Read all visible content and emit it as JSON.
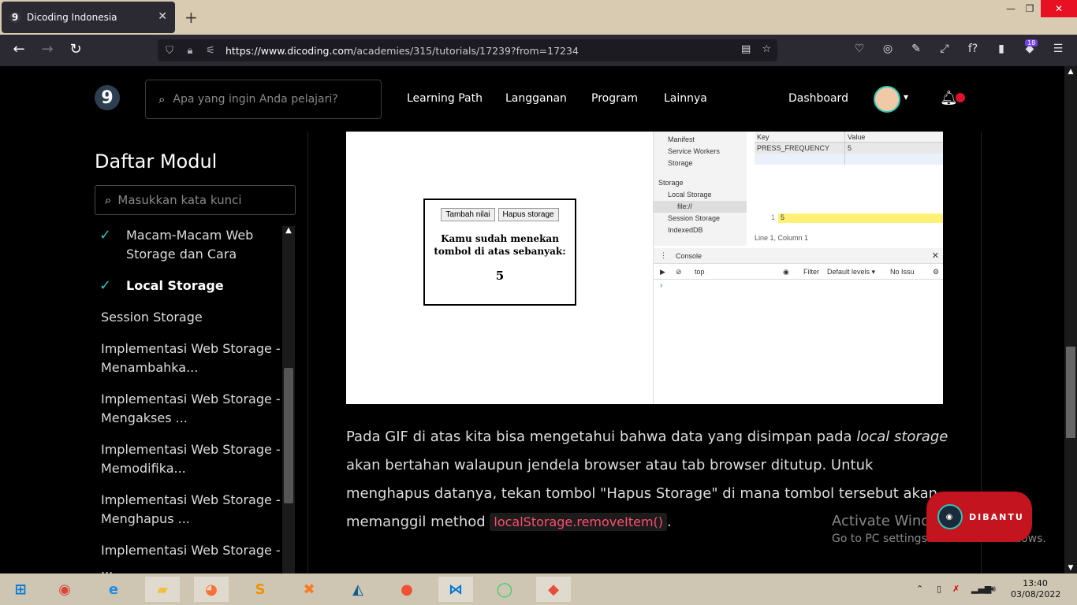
{
  "browser": {
    "tab_title": "Dicoding Indonesia",
    "url_host": "https://www.dicoding.com",
    "url_path": "/academies/315/tutorials/17239?from=17234",
    "extension_badge": "18"
  },
  "header": {
    "logo": "9",
    "search_placeholder": "Apa yang ingin Anda pelajari?",
    "menu": [
      "Learning Path",
      "Langganan",
      "Program",
      "Lainnya"
    ],
    "dashboard": "Dashboard"
  },
  "sidebar": {
    "title": "Daftar Modul",
    "search_placeholder": "Masukkan kata kunci",
    "items": [
      {
        "label": "Macam-Macam Web Storage dan Cara",
        "done": true
      },
      {
        "label": "Local Storage",
        "done": true,
        "active": true
      },
      {
        "label": "Session Storage"
      },
      {
        "label": "Implementasi Web Storage - Menambahka..."
      },
      {
        "label": "Implementasi Web Storage - Mengakses ..."
      },
      {
        "label": "Implementasi Web Storage - Memodifika..."
      },
      {
        "label": "Implementasi Web Storage - Menghapus ..."
      },
      {
        "label": "Implementasi Web Storage - ..."
      }
    ]
  },
  "gif": {
    "btn_add": "Tambah nilai",
    "btn_clear": "Hapus storage",
    "text": "Kamu sudah menekan tombol di atas sebanyak:",
    "count": "5",
    "devtools": {
      "side": [
        "Manifest",
        "Service Workers",
        "Storage"
      ],
      "storage_header": "Storage",
      "storage_items": [
        "Local Storage",
        "file://",
        "Session Storage",
        "IndexedDB"
      ],
      "col_key": "Key",
      "col_value": "Value",
      "row_key": "PRESS_FREQUENCY",
      "row_value": "5",
      "preview_line": "1",
      "preview_value": "5",
      "status": "Line 1, Column 1",
      "console_tab": "Console",
      "context": "top",
      "filter": "Filter",
      "levels": "Default levels ▾",
      "issues": "No Issu"
    }
  },
  "paragraph": {
    "part1": "Pada GIF di atas kita bisa mengetahui bahwa data yang disimpan pada ",
    "italic": "local storage",
    "part2": " akan bertahan walaupun jendela browser atau tab browser ditutup. Untuk menghapus datanya, tekan tombol \"Hapus Storage\" di mana tombol tersebut akan memanggil method ",
    "code": "localStorage.removeItem()",
    "end": "."
  },
  "chat_widget": {
    "label": "DIBANTU"
  },
  "watermark": {
    "title": "Activate Windows",
    "subtitle": "Go to PC settings to activate Windows."
  },
  "taskbar": {
    "time": "13:40",
    "date": "03/08/2022"
  }
}
